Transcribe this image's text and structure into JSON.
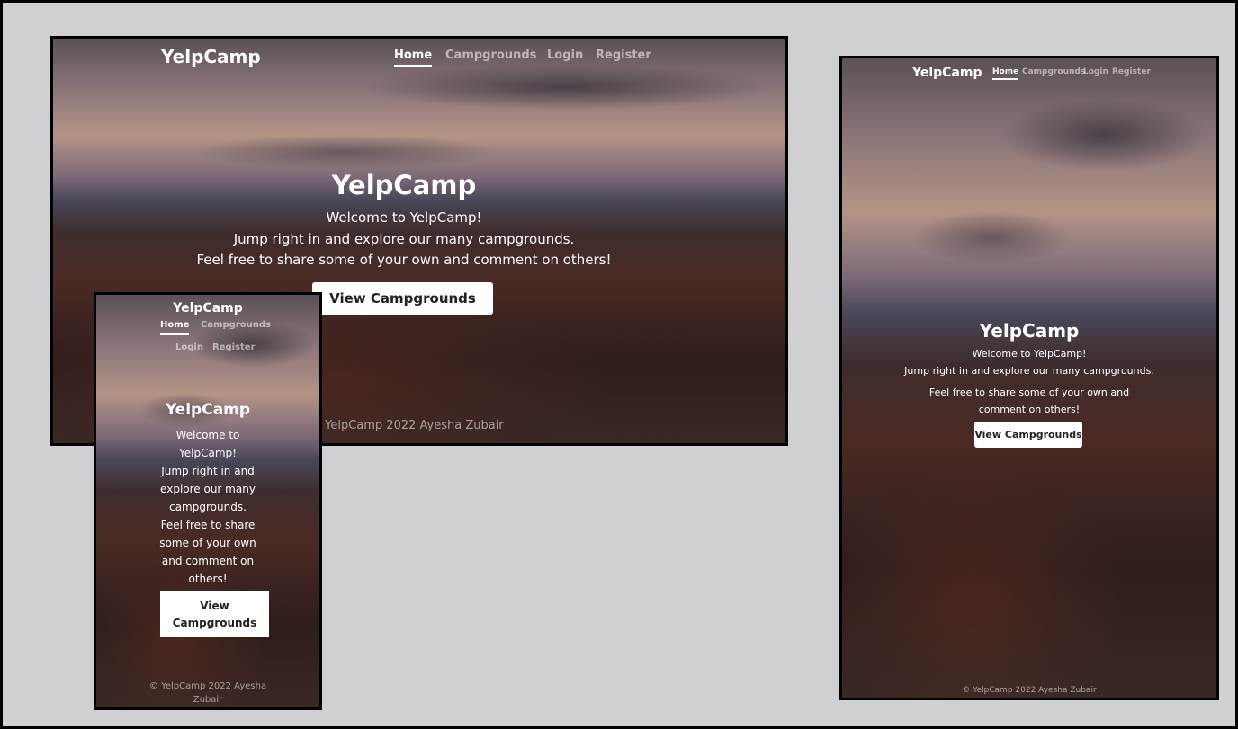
{
  "brand": "YelpCamp",
  "nav": [
    {
      "label": "Home",
      "active": true
    },
    {
      "label": "Campgrounds"
    },
    {
      "label": "Login"
    },
    {
      "label": "Register"
    }
  ],
  "hero": {
    "title": "YelpCamp",
    "lines": [
      "Welcome to YelpCamp!",
      "Jump right in and explore our many campgrounds.",
      "Feel free to share some of your own and comment on others!"
    ],
    "button": "View Campgrounds"
  },
  "footer": "© YelpCamp 2022 Ayesha Zubair",
  "colors": {
    "background": "#d0d0d2",
    "button": "#ffffff",
    "frame_border": "#000000"
  }
}
